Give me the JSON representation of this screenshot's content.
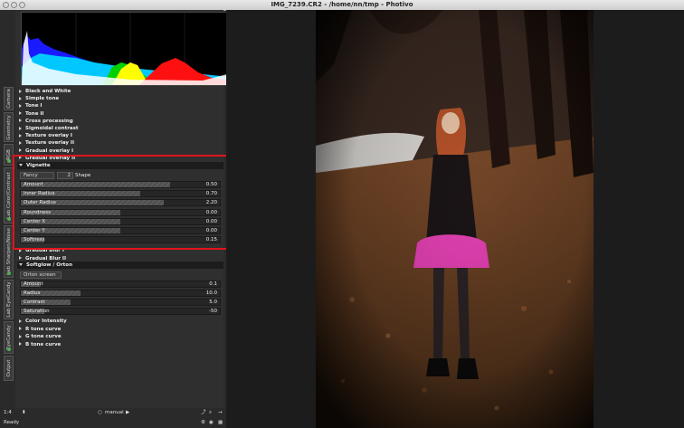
{
  "window": {
    "title": "IMG_7239.CR2 - /home/nn/tmp - Photivo"
  },
  "vertical_tabs": [
    "Camera",
    "Geometry",
    "RGB",
    "Lab Color/Contrast",
    "Lab Sharpen/Noise",
    "Lab EyeCandy",
    "EyeCandy",
    "Output"
  ],
  "modules_top": [
    "Black and White",
    "Simple tone",
    "Tone I",
    "Tone II",
    "Cross processing",
    "Sigmoidal contrast",
    "Texture overlay I",
    "Texture overlay II",
    "Gradual overlay I",
    "Gradual overlay II"
  ],
  "vignette": {
    "header": "Vignette",
    "mode": "Fancy",
    "shape_value": "2",
    "shape_label": "Shape",
    "sliders": [
      {
        "label": "Amount",
        "value": "0.50",
        "fraction": 0.75
      },
      {
        "label": "Inner Radius",
        "value": "0.70",
        "fraction": 0.6
      },
      {
        "label": "Outer Radius",
        "value": "2.20",
        "fraction": 0.72
      },
      {
        "label": "Roundness",
        "value": "0.00",
        "fraction": 0.5
      },
      {
        "label": "Center X",
        "value": "0.00",
        "fraction": 0.5
      },
      {
        "label": "Center Y",
        "value": "0.00",
        "fraction": 0.5
      },
      {
        "label": "Softness",
        "value": "0.15",
        "fraction": 0.12
      }
    ]
  },
  "modules_mid": [
    "Gradual Blur I",
    "Gradual Blur II"
  ],
  "softglow": {
    "header": "Softglow / Orton",
    "mode": "Orton screen",
    "sliders": [
      {
        "label": "Amount",
        "value": "0.1",
        "fraction": 0.1
      },
      {
        "label": "Radius",
        "value": "10.0",
        "fraction": 0.3
      },
      {
        "label": "Contrast",
        "value": "5.0",
        "fraction": 0.25
      },
      {
        "label": "Saturation",
        "value": "-50",
        "fraction": 0.12
      }
    ]
  },
  "modules_bottom": [
    "Color Intensity",
    "R tone curve",
    "G tone curve",
    "B tone curve"
  ],
  "bottombar": {
    "zoom": "1:4",
    "mode": "manual"
  },
  "status": {
    "text": "Ready"
  },
  "colors": {
    "highlight_box": "#e0141e",
    "active_dot": "#4caf50"
  }
}
